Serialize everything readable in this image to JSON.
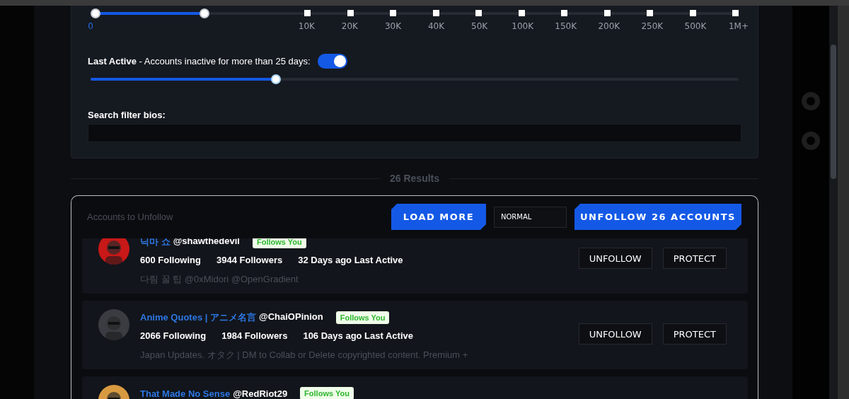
{
  "followers_filter": {
    "level": 0.171,
    "ticks": [
      {
        "label": "0",
        "selected": true
      },
      {
        "label": "10K",
        "selected": false
      },
      {
        "label": "20K",
        "selected": false
      },
      {
        "label": "30K",
        "selected": false
      },
      {
        "label": "40K",
        "selected": false
      },
      {
        "label": "50K",
        "selected": false
      },
      {
        "label": "100K",
        "selected": false
      },
      {
        "label": "150K",
        "selected": false
      },
      {
        "label": "200K",
        "selected": false
      },
      {
        "label": "250K",
        "selected": false
      },
      {
        "label": "500K",
        "selected": false
      },
      {
        "label": "1M+",
        "selected": false
      }
    ]
  },
  "last_active": {
    "label": "**Last Active** - Accounts inactive for more than 25 days:",
    "on": true,
    "level": 0.283
  },
  "bio_search": {
    "label": "Search filter bios:"
  },
  "results_count": "26 Results",
  "results": {
    "title": "Accounts to Unfollow",
    "load_more": "LOAD MORE",
    "mode": "NORMAL",
    "unfollow_all": "UNFOLLOW 26 ACCOUNTS",
    "accounts": [
      {
        "name": "닉마 쇼",
        "handle": "@shawthedevil",
        "badge": "Follows You",
        "following": "600 Following",
        "followers": "3944 Followers",
        "last_active": "32 Days ago Last Active",
        "bio": "다림 꿀 팁 @0xMidori @OpenGradient",
        "buttons": [
          "UNFOLLOW",
          "PROTECT"
        ],
        "color": "#c81818"
      },
      {
        "name": "Anime Quotes | アニメ名言",
        "handle": "@ChaiOPinion",
        "badge": "Follows You",
        "following": "2066 Following",
        "followers": "1984 Followers",
        "last_active": "106 Days ago Last Active",
        "bio": "Japan Updates. オタク | DM to Collab or Delete copyrighted content. Premium +",
        "buttons": [
          "UNFOLLOW",
          "PROTECT"
        ],
        "color": "#3a3c42"
      },
      {
        "name": "That Made No Sense",
        "handle": "@RedRiot29",
        "badge": "Follows You",
        "color": "#d89a40"
      }
    ]
  }
}
